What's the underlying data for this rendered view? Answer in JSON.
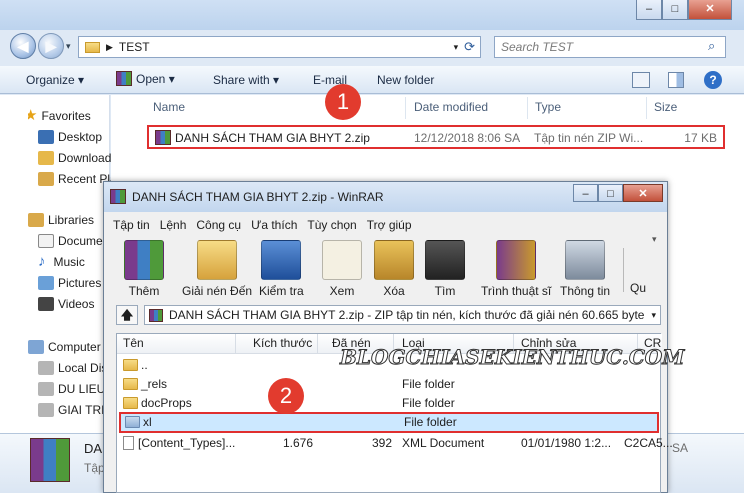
{
  "explorer": {
    "address": {
      "crumb": "TEST"
    },
    "search_placeholder": "Search TEST",
    "commands": {
      "organize": "Organize",
      "open": "Open",
      "share": "Share with",
      "email": "E-mail",
      "new_folder": "New folder"
    },
    "sidebar": {
      "favorites": "Favorites",
      "desktop": "Desktop",
      "downloads": "Downloads",
      "recent": "Recent Places",
      "libraries": "Libraries",
      "documents": "Documents",
      "music": "Music",
      "pictures": "Pictures",
      "videos": "Videos",
      "computer": "Computer",
      "local_disk": "Local Disk",
      "du_lieu": "DU LIEU",
      "giai_tri": "GIAI TRI"
    },
    "columns": {
      "name": "Name",
      "date": "Date modified",
      "type": "Type",
      "size": "Size"
    },
    "file": {
      "name": "DANH SÁCH THAM GIA BHYT 2.zip",
      "date": "12/12/2018 8:06 SA",
      "type": "Tập tin nén ZIP Wi...",
      "size": "17 KB"
    },
    "details": {
      "name": "DA",
      "type": "Tập",
      "right_text": "SA"
    }
  },
  "badges": {
    "one": "1",
    "two": "2"
  },
  "winrar": {
    "title": "DANH SÁCH THAM GIA BHYT 2.zip - WinRAR",
    "menu": [
      "Tập tin",
      "Lệnh",
      "Công cụ",
      "Ưa thích",
      "Tùy chọn",
      "Trợ giúp"
    ],
    "toolbar": {
      "add": "Thêm",
      "extract": "Giải nén Đến",
      "test": "Kiểm tra",
      "view": "Xem",
      "delete": "Xóa",
      "find": "Tìm",
      "wizard": "Trình thuật sĩ",
      "info": "Thông tin",
      "more": "Qu"
    },
    "path": "DANH SÁCH THAM GIA BHYT 2.zip - ZIP tập tin nén, kích thước đã giải nén 60.665 byte",
    "columns": {
      "name": "Tên",
      "size": "Kích thước",
      "packed": "Đã nén",
      "type": "Loại",
      "modified": "Chỉnh sửa",
      "crc": "CR"
    },
    "rows": [
      {
        "name": "..",
        "size": "",
        "packed": "",
        "type": "",
        "modified": "",
        "crc": ""
      },
      {
        "name": "_rels",
        "size": "",
        "packed": "",
        "type": "File folder",
        "modified": "",
        "crc": ""
      },
      {
        "name": "docProps",
        "size": "",
        "packed": "",
        "type": "File folder",
        "modified": "",
        "crc": ""
      },
      {
        "name": "xl",
        "size": "",
        "packed": "",
        "type": "File folder",
        "modified": "",
        "crc": ""
      },
      {
        "name": "[Content_Types]...",
        "size": "1.676",
        "packed": "392",
        "type": "XML Document",
        "modified": "01/01/1980 1:2...",
        "crc": "C2CA5..."
      }
    ]
  },
  "watermark": "BLOGCHIASEKIENTHUC.COM"
}
